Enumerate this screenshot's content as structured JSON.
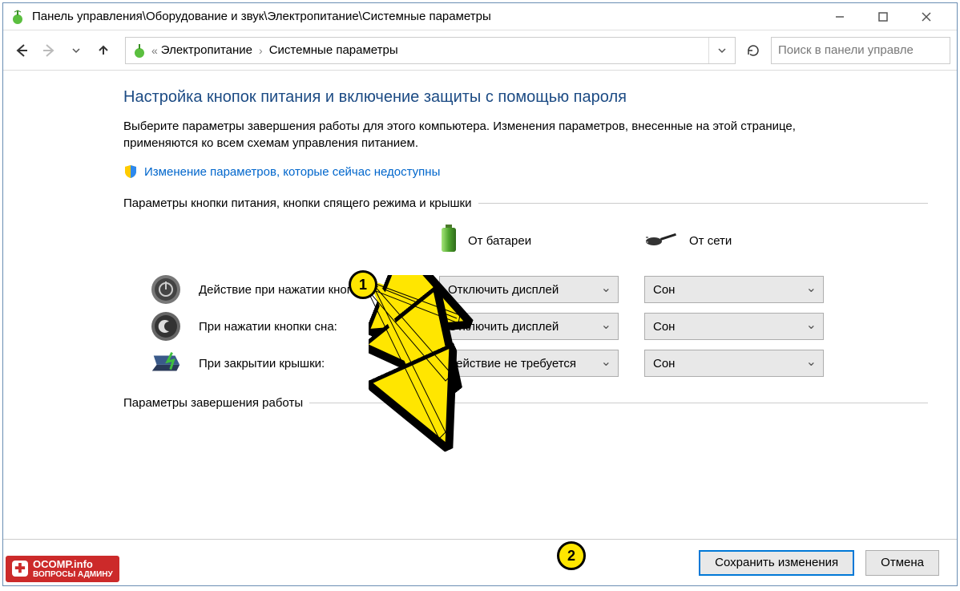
{
  "titlebar": {
    "path": "Панель управления\\Оборудование и звук\\Электропитание\\Системные параметры"
  },
  "breadcrumb": {
    "item1": "Электропитание",
    "item2": "Системные параметры"
  },
  "search": {
    "placeholder": "Поиск в панели управле"
  },
  "main": {
    "heading": "Настройка кнопок питания и включение защиты с помощью пароля",
    "description": "Выберите параметры завершения работы для этого компьютера. Изменения параметров, внесенные на этой странице, применяются ко всем схемам управления питанием.",
    "admin_link": "Изменение параметров, которые сейчас недоступны",
    "section1_title": "Параметры кнопки питания, кнопки спящего режима и крышки",
    "col_battery": "От батареи",
    "col_ac": "От сети",
    "rows": [
      {
        "label": "Действие при нажатии кнопки питания:",
        "battery": "Отключить дисплей",
        "ac": "Сон"
      },
      {
        "label": "При нажатии кнопки сна:",
        "battery": "Отключить дисплей",
        "ac": "Сон"
      },
      {
        "label": "При закрытии крышки:",
        "battery": "Действие не требуется",
        "ac": "Сон"
      }
    ],
    "section2_title": "Параметры завершения работы"
  },
  "footer": {
    "save": "Сохранить изменения",
    "cancel": "Отмена"
  },
  "annotations": {
    "badge1": "1",
    "badge2": "2"
  },
  "watermark": {
    "line1": "OCOMP.info",
    "line2": "ВОПРОСЫ АДМИНУ"
  }
}
